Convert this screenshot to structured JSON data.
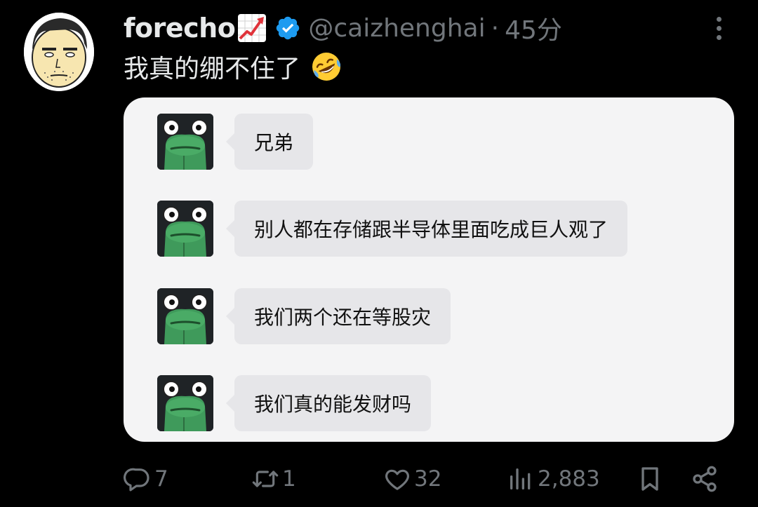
{
  "author": {
    "display_name": "forecho",
    "name_emoji": "chart-increasing-icon",
    "verified": true,
    "handle": "@caizhenghai",
    "separator": "·",
    "time": "45分"
  },
  "tweet": {
    "text": "我真的绷不住了",
    "emoji": "rolling-on-floor-laughing-icon"
  },
  "media": {
    "messages": [
      {
        "text": "兄弟"
      },
      {
        "text": "别人都在存储跟半导体里面吃成巨人观了"
      },
      {
        "text": "我们两个还在等股灾"
      },
      {
        "text": "我们真的能发财吗"
      }
    ]
  },
  "actions": {
    "reply_count": "7",
    "retweet_count": "1",
    "like_count": "32",
    "view_count": "2,883"
  },
  "colors": {
    "background": "#000000",
    "text_primary": "#e7e9ea",
    "text_secondary": "#71767b",
    "verified_blue": "#1d9bf0",
    "card_bg": "#f4f4f5",
    "bubble_bg": "#e6e6e9"
  }
}
